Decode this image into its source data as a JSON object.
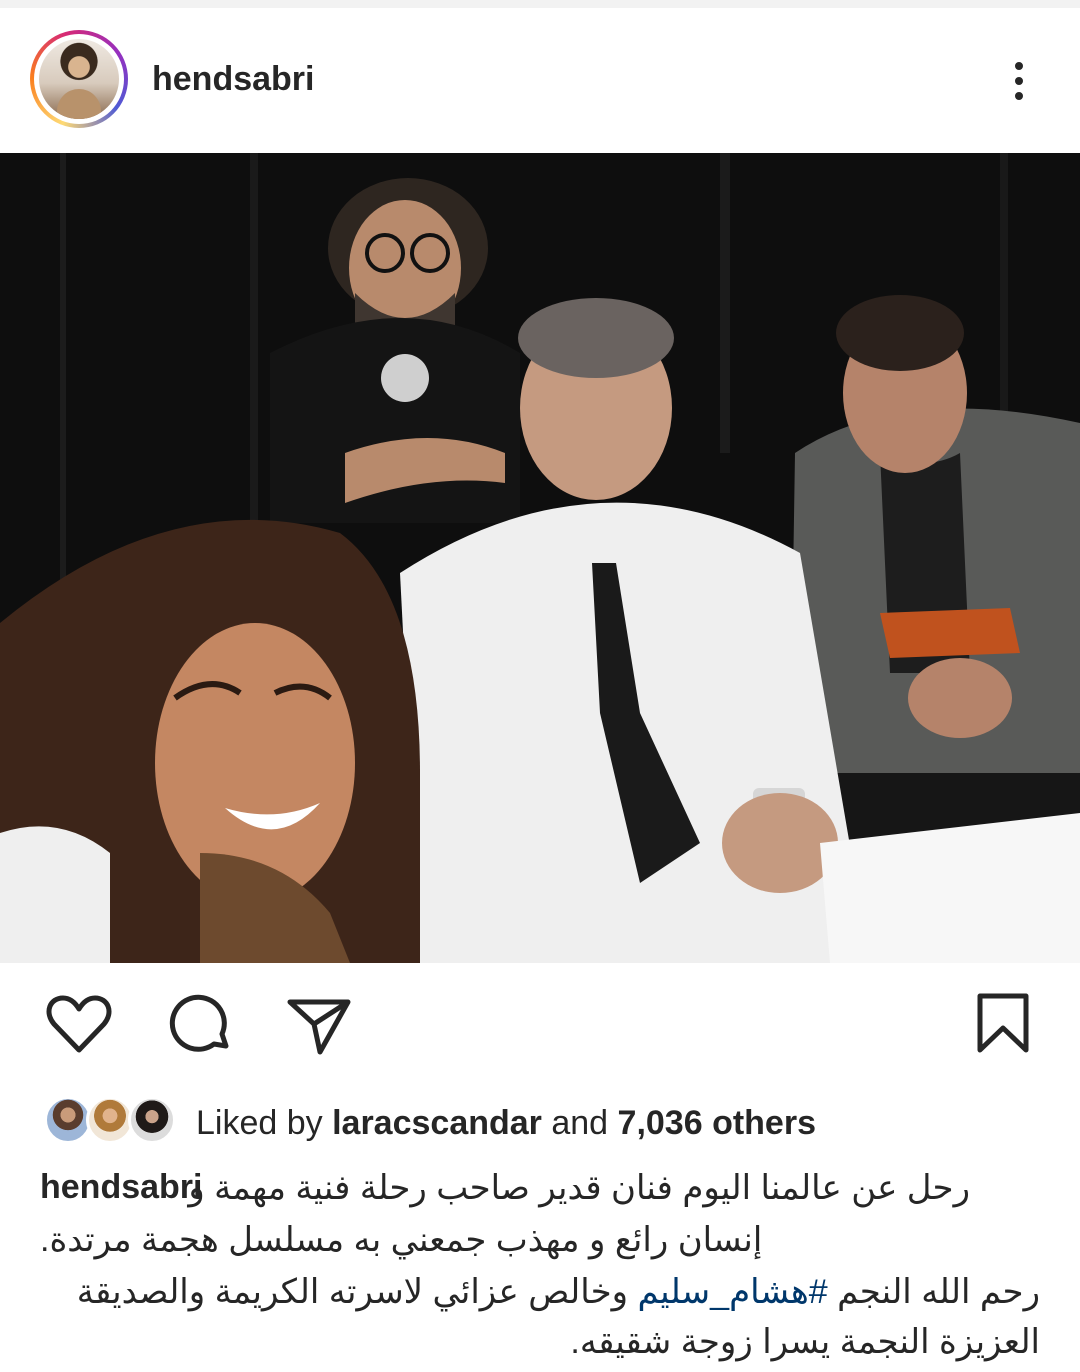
{
  "post": {
    "username": "hendsabri",
    "more_icon": "more-vertical-icon"
  },
  "actions": {
    "like_icon": "heart-icon",
    "comment_icon": "comment-icon",
    "share_icon": "send-icon",
    "save_icon": "bookmark-icon"
  },
  "likes": {
    "prefix": "Liked by",
    "user": "laracscandar",
    "connector": "and",
    "count": "7,036 others"
  },
  "caption": {
    "username": "hendsabri",
    "line1": "رحل عن عالمنا اليوم فنان قدير صاحب رحلة فنية مهمة و",
    "line2": "إنسان رائع و مهذب جمعني به مسلسل هجمة مرتدة.",
    "line3_prefix": "رحم الله النجم",
    "hashtag": "#هشام_سليم",
    "line3_suffix": "وخالص عزائي لاسرته الكريمة والصديقة",
    "line4": "العزيزة النجمة يسرا زوجة شقيقه."
  },
  "colors": {
    "text": "#262626",
    "hashtag": "#00376b",
    "background": "#ffffff"
  }
}
